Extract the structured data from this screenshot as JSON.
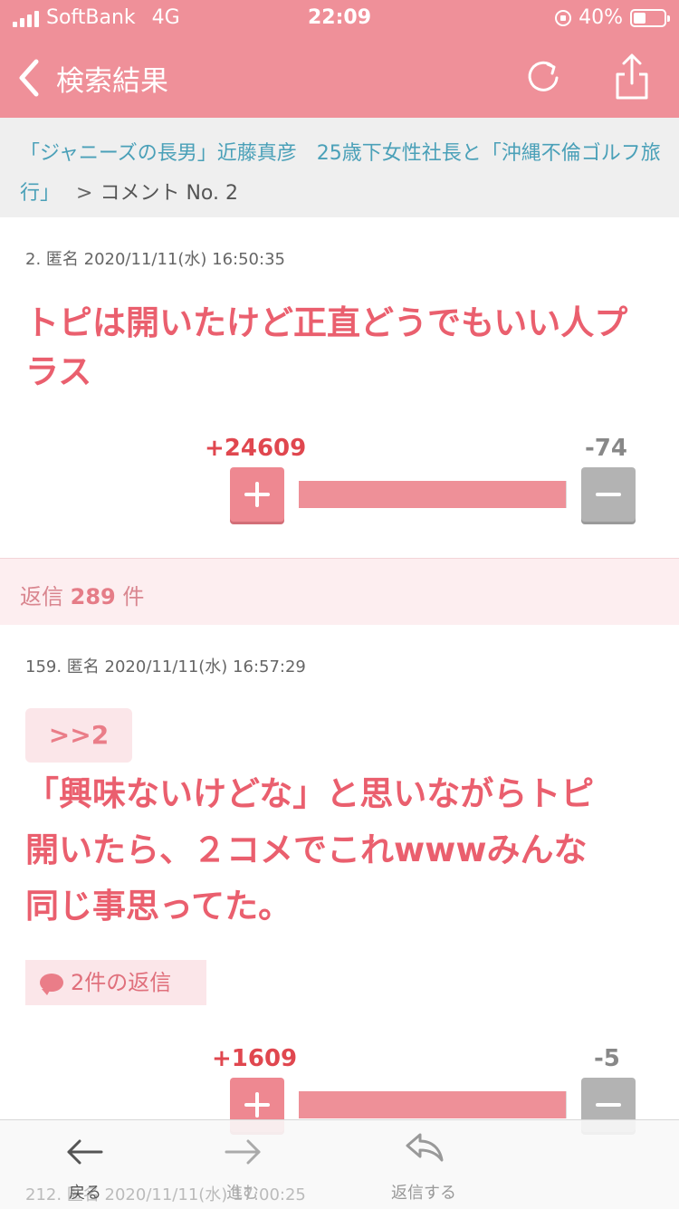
{
  "status_bar": {
    "carrier": "SoftBank",
    "network": "4G",
    "time": "22:09",
    "battery_text": "40%",
    "battery_level": 0.4
  },
  "nav": {
    "title": "検索結果",
    "back_icon": "chevron-left-icon",
    "reload_icon": "reload-icon",
    "share_icon": "share-icon"
  },
  "breadcrumb": {
    "topic": "「ジャニーズの長男」近藤真彦　25歳下女性社長と「沖縄不倫ゴルフ旅行」",
    "separator": ">",
    "current": "コメント No. 2"
  },
  "comment_main": {
    "meta": "2. 匿名 2020/11/11(水) 16:50:35",
    "body": "トピは開いたけど正直どうでもいい人プラス",
    "plus": "+24609",
    "minus": "-74",
    "plus_ratio": 0.997
  },
  "replies_summary": {
    "label": "返信",
    "count": "289",
    "unit": "件"
  },
  "comment_reply": {
    "meta": "159. 匿名 2020/11/11(水) 16:57:29",
    "anchor": ">>2",
    "body_lines": [
      "「興味ないけどな」と思いながらトピ",
      "開いたら、２コメでこれwwwみんな",
      "同じ事思ってた。"
    ],
    "replies_chip": "2件の返信",
    "plus": "+1609",
    "minus": "-5",
    "plus_ratio": 0.997
  },
  "comment_next_partial": {
    "meta": "212. 匿名 2020/11/11(水) 17:00:25"
  },
  "tab_bar": {
    "back": "戻る",
    "forward": "進む",
    "reply": "返信する"
  },
  "colors": {
    "accent": "#ef9099",
    "body_text": "#ea5f6e",
    "link": "#4aa0b8"
  }
}
